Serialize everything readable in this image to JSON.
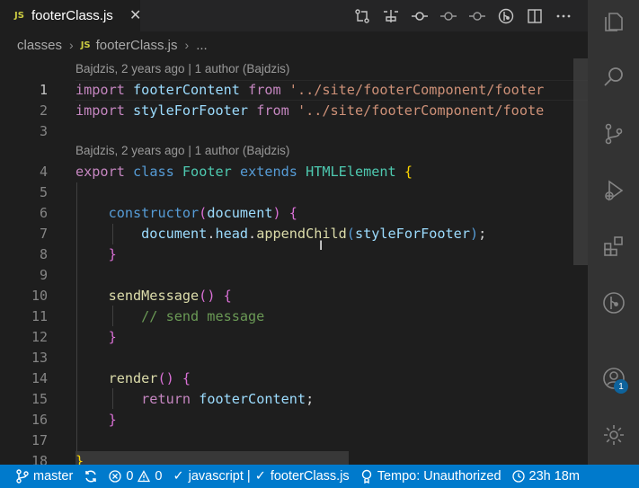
{
  "tab": {
    "badge": "JS",
    "title": "footerClass.js"
  },
  "toolbar": [
    "compare-changes-icon",
    "open-changes-icon",
    "git-commit-icon",
    "previous-change-icon",
    "next-change-icon",
    "git-graph-icon",
    "split-editor-icon",
    "more-actions-icon"
  ],
  "breadcrumbs": {
    "folder": "classes",
    "badge": "JS",
    "file": "footerClass.js",
    "more": "..."
  },
  "codelens": [
    {
      "before_line": 1,
      "text": "Bajdzis, 2 years ago | 1 author (Bajdzis)"
    },
    {
      "before_line": 4,
      "text": "Bajdzis, 2 years ago | 1 author (Bajdzis)"
    }
  ],
  "lines": [
    {
      "num": "1",
      "tokens": [
        [
          "k",
          "import"
        ],
        [
          "p",
          " "
        ],
        [
          "v",
          "footerContent"
        ],
        [
          "p",
          " "
        ],
        [
          "k",
          "from"
        ],
        [
          "p",
          " "
        ],
        [
          "s",
          "'../site/footerComponent/footer"
        ]
      ]
    },
    {
      "num": "2",
      "tokens": [
        [
          "k",
          "import"
        ],
        [
          "p",
          " "
        ],
        [
          "v",
          "styleForFooter"
        ],
        [
          "p",
          " "
        ],
        [
          "k",
          "from"
        ],
        [
          "p",
          " "
        ],
        [
          "s",
          "'../site/footerComponent/foote"
        ]
      ]
    },
    {
      "num": "3",
      "tokens": []
    },
    {
      "num": "4",
      "tokens": [
        [
          "k",
          "export"
        ],
        [
          "p",
          " "
        ],
        [
          "kb",
          "class"
        ],
        [
          "p",
          " "
        ],
        [
          "c",
          "Footer"
        ],
        [
          "p",
          " "
        ],
        [
          "kb",
          "extends"
        ],
        [
          "p",
          " "
        ],
        [
          "c",
          "HTMLElement"
        ],
        [
          "p",
          " "
        ],
        [
          "b1",
          "{"
        ]
      ]
    },
    {
      "num": "5",
      "tokens": []
    },
    {
      "num": "6",
      "tokens": [
        [
          "p",
          "    "
        ],
        [
          "kb",
          "constructor"
        ],
        [
          "b2",
          "("
        ],
        [
          "v",
          "document"
        ],
        [
          "b2",
          ")"
        ],
        [
          "p",
          " "
        ],
        [
          "b2",
          "{"
        ]
      ]
    },
    {
      "num": "7",
      "tokens": [
        [
          "p",
          "        "
        ],
        [
          "v",
          "document"
        ],
        [
          "p",
          "."
        ],
        [
          "v",
          "head"
        ],
        [
          "p",
          "."
        ],
        [
          "f",
          "appendChild"
        ],
        [
          "kb",
          "("
        ],
        [
          "v",
          "styleForFooter"
        ],
        [
          "kb",
          ")"
        ],
        [
          "p",
          ";"
        ]
      ]
    },
    {
      "num": "8",
      "tokens": [
        [
          "p",
          "    "
        ],
        [
          "b2",
          "}"
        ]
      ]
    },
    {
      "num": "9",
      "tokens": []
    },
    {
      "num": "10",
      "tokens": [
        [
          "p",
          "    "
        ],
        [
          "f",
          "sendMessage"
        ],
        [
          "b2",
          "()"
        ],
        [
          "p",
          " "
        ],
        [
          "b2",
          "{"
        ]
      ]
    },
    {
      "num": "11",
      "tokens": [
        [
          "p",
          "        "
        ],
        [
          "cm",
          "// send message"
        ]
      ]
    },
    {
      "num": "12",
      "tokens": [
        [
          "p",
          "    "
        ],
        [
          "b2",
          "}"
        ]
      ]
    },
    {
      "num": "13",
      "tokens": []
    },
    {
      "num": "14",
      "tokens": [
        [
          "p",
          "    "
        ],
        [
          "f",
          "render"
        ],
        [
          "b2",
          "()"
        ],
        [
          "p",
          " "
        ],
        [
          "b2",
          "{"
        ]
      ]
    },
    {
      "num": "15",
      "tokens": [
        [
          "p",
          "        "
        ],
        [
          "k",
          "return"
        ],
        [
          "p",
          " "
        ],
        [
          "v",
          "footerContent"
        ],
        [
          "p",
          ";"
        ]
      ]
    },
    {
      "num": "16",
      "tokens": [
        [
          "p",
          "    "
        ],
        [
          "b2",
          "}"
        ]
      ]
    },
    {
      "num": "17",
      "tokens": []
    },
    {
      "num": "18",
      "tokens": [
        [
          "b1",
          "}"
        ]
      ]
    }
  ],
  "activity_bar": [
    {
      "name": "explorer-icon"
    },
    {
      "name": "search-icon"
    },
    {
      "name": "source-control-icon"
    },
    {
      "name": "run-debug-icon"
    },
    {
      "name": "extensions-icon"
    },
    {
      "name": "git-graph-icon"
    },
    {
      "name": "account-icon",
      "badge": "1"
    },
    {
      "name": "settings-gear-icon"
    }
  ],
  "status": {
    "branch": "master",
    "errors": "0",
    "warnings": "0",
    "language": "javascript | ",
    "file": "footerClass.js",
    "tempo": "Tempo: Unauthorized",
    "time": "23h 18m"
  },
  "colors": {
    "accent": "#007acc",
    "editor_bg": "#1e1e1e",
    "activity_bg": "#333333",
    "js_badge": "#cbcb41"
  }
}
